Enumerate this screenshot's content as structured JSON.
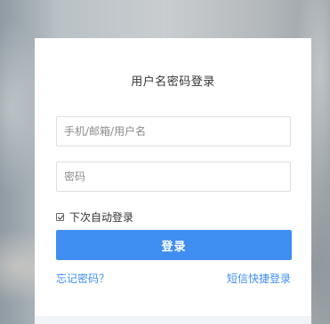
{
  "login": {
    "title": "用户名密码登录",
    "username_placeholder": "手机/邮箱/用户名",
    "password_placeholder": "密码",
    "remember_label": "下次自动登录",
    "remember_checked": true,
    "submit_label": "登录",
    "forgot_link": "忘记密码？",
    "sms_link": "短信快捷登录"
  },
  "colors": {
    "accent": "#3f8ef2",
    "card_background": "#ffffff",
    "input_border": "#dcdfe3"
  }
}
